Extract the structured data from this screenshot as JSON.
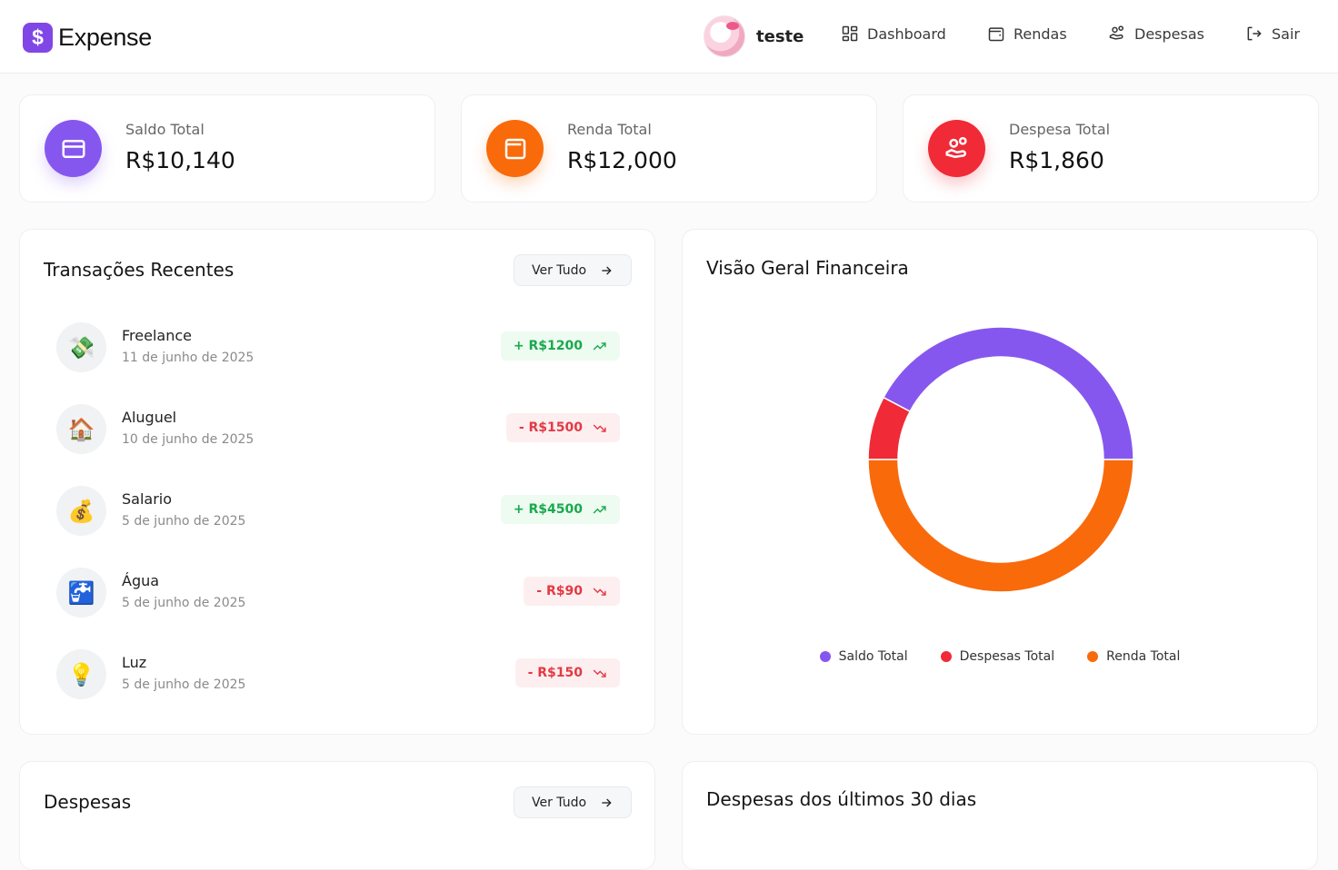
{
  "header": {
    "logo_symbol": "$",
    "logo_text": "Expense",
    "user_name": "teste",
    "nav": [
      {
        "label": "Dashboard",
        "icon": "grid-icon"
      },
      {
        "label": "Rendas",
        "icon": "wallet-icon"
      },
      {
        "label": "Despesas",
        "icon": "hand-coins-icon"
      },
      {
        "label": "Sair",
        "icon": "logout-icon"
      }
    ]
  },
  "stats": [
    {
      "label": "Saldo Total",
      "value": "R$10,140",
      "color": "#8657ef",
      "icon": "card-icon"
    },
    {
      "label": "Renda Total",
      "value": "R$12,000",
      "color": "#f96a0b",
      "icon": "wallet-icon"
    },
    {
      "label": "Despesa Total",
      "value": "R$1,860",
      "color": "#f12a37",
      "icon": "hand-coins-icon"
    }
  ],
  "recent": {
    "title": "Transações Recentes",
    "see_all": "Ver Tudo",
    "items": [
      {
        "name": "Freelance",
        "date": "11 de junho de 2025",
        "amount": "+ R$1200",
        "icon": "💸",
        "type": "income"
      },
      {
        "name": "Aluguel",
        "date": "10 de junho de 2025",
        "amount": "- R$1500",
        "icon": "🏠",
        "type": "expense"
      },
      {
        "name": "Salario",
        "date": "5 de junho de 2025",
        "amount": "+ R$4500",
        "icon": "💰",
        "type": "income"
      },
      {
        "name": "Água",
        "date": "5 de junho de 2025",
        "amount": "- R$90",
        "icon": "🚰",
        "type": "expense"
      },
      {
        "name": "Luz",
        "date": "5 de junho de 2025",
        "amount": "- R$150",
        "icon": "💡",
        "type": "expense"
      }
    ]
  },
  "overview": {
    "title": "Visão Geral Financeira"
  },
  "chart_data": {
    "type": "pie",
    "categories": [
      "Saldo Total",
      "Despesas Total",
      "Renda Total"
    ],
    "values": [
      10140,
      1860,
      12000
    ],
    "colors": [
      "#8657ef",
      "#f12a37",
      "#f96a0b"
    ],
    "legend": "bottom"
  },
  "expenses": {
    "title": "Despesas",
    "see_all": "Ver Tudo"
  },
  "last30": {
    "title": "Despesas dos últimos 30 dias"
  }
}
